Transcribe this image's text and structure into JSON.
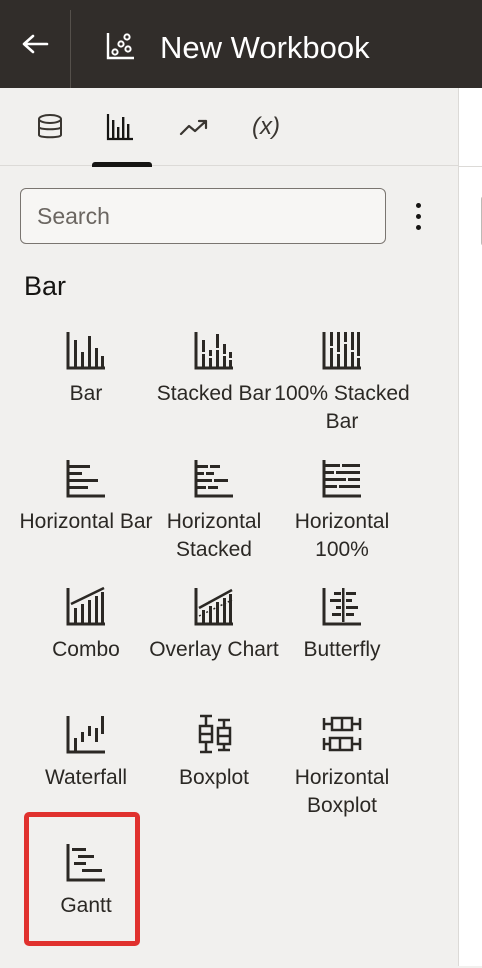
{
  "header": {
    "back_icon": "arrow-left-icon",
    "workbook_icon": "workbook-scatter-icon",
    "title": "New Workbook"
  },
  "tabs": [
    {
      "name": "data",
      "icon": "database-icon"
    },
    {
      "name": "visualizations",
      "icon": "bar-chart-icon",
      "active": true
    },
    {
      "name": "analytics",
      "icon": "trend-arrow-icon"
    },
    {
      "name": "calculations",
      "label": "(x)"
    }
  ],
  "search": {
    "placeholder": "Search",
    "value": ""
  },
  "section": {
    "title": "Bar"
  },
  "tiles": [
    {
      "label": "Bar",
      "icon": "bar-chart-icon"
    },
    {
      "label": "Stacked Bar",
      "icon": "stacked-bar-icon"
    },
    {
      "label": "100% Stacked Bar",
      "icon": "stacked-bar-100-icon"
    },
    {
      "label": "Horizontal Bar",
      "icon": "horizontal-bar-icon"
    },
    {
      "label": "Horizontal Stacked",
      "icon": "horizontal-stacked-icon"
    },
    {
      "label": "Horizontal 100%",
      "icon": "horizontal-100-icon"
    },
    {
      "label": "Combo",
      "icon": "combo-chart-icon"
    },
    {
      "label": "Overlay Chart",
      "icon": "overlay-chart-icon"
    },
    {
      "label": "Butterfly",
      "icon": "butterfly-chart-icon"
    },
    {
      "label": "Waterfall",
      "icon": "waterfall-chart-icon"
    },
    {
      "label": "Boxplot",
      "icon": "boxplot-icon"
    },
    {
      "label": "Horizontal Boxplot",
      "icon": "horizontal-boxplot-icon"
    },
    {
      "label": "Gantt",
      "icon": "gantt-chart-icon",
      "highlighted": true
    }
  ],
  "colors": {
    "header_bg": "#312d2a",
    "highlight": "#e0312e",
    "panel_bg": "#f1f0ee"
  }
}
